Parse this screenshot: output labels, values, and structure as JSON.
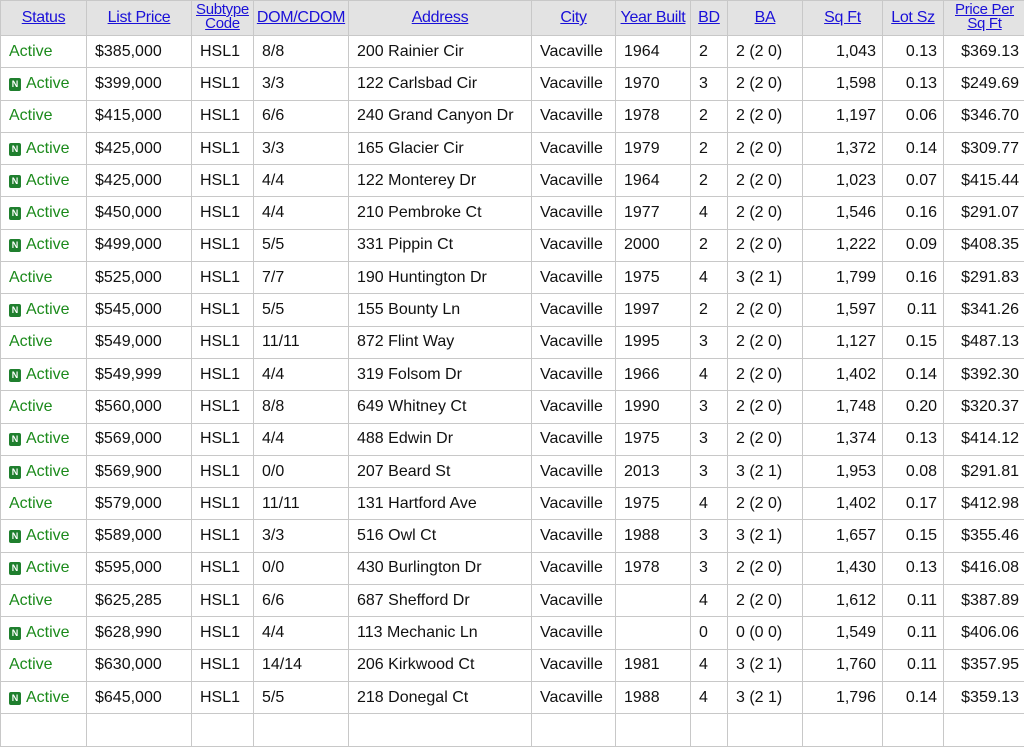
{
  "colors": {
    "header_bg": "#e3e3e3",
    "header_link": "#1a10d8",
    "status_active": "#1b8a1b",
    "new_badge": "#1f7f2e",
    "grid_line": "#c8c8c8"
  },
  "new_badge_text": "N",
  "columns": [
    {
      "key": "status",
      "label": "Status",
      "lines": [
        "Status"
      ]
    },
    {
      "key": "list_price",
      "label": "List Price",
      "lines": [
        "List Price"
      ]
    },
    {
      "key": "subtype",
      "label": "Subtype Code",
      "lines": [
        "Subtype",
        "Code"
      ]
    },
    {
      "key": "dom",
      "label": "DOM/CDOM",
      "lines": [
        "DOM/CDOM"
      ]
    },
    {
      "key": "address",
      "label": "Address",
      "lines": [
        "Address"
      ]
    },
    {
      "key": "city",
      "label": "City",
      "lines": [
        "City"
      ]
    },
    {
      "key": "year_built",
      "label": "Year Built",
      "lines": [
        "Year Built"
      ]
    },
    {
      "key": "bd",
      "label": "BD",
      "lines": [
        "BD"
      ]
    },
    {
      "key": "ba",
      "label": "BA",
      "lines": [
        "BA"
      ]
    },
    {
      "key": "sqft",
      "label": "Sq Ft",
      "lines": [
        "Sq Ft"
      ]
    },
    {
      "key": "lot",
      "label": "Lot Sz",
      "lines": [
        "Lot Sz"
      ]
    },
    {
      "key": "ppsf",
      "label": "Price Per Sq Ft",
      "lines": [
        "Price Per",
        "Sq Ft"
      ]
    }
  ],
  "rows": [
    {
      "is_new": false,
      "status": "Active",
      "list_price": "$385,000",
      "subtype": "HSL1",
      "dom": "8/8",
      "address": "200 Rainier Cir",
      "city": "Vacaville",
      "year_built": "1964",
      "bd": "2",
      "ba": "2 (2 0)",
      "sqft": "1,043",
      "lot": "0.13",
      "ppsf": "$369.13"
    },
    {
      "is_new": true,
      "status": "Active",
      "list_price": "$399,000",
      "subtype": "HSL1",
      "dom": "3/3",
      "address": "122 Carlsbad Cir",
      "city": "Vacaville",
      "year_built": "1970",
      "bd": "3",
      "ba": "2 (2 0)",
      "sqft": "1,598",
      "lot": "0.13",
      "ppsf": "$249.69"
    },
    {
      "is_new": false,
      "status": "Active",
      "list_price": "$415,000",
      "subtype": "HSL1",
      "dom": "6/6",
      "address": "240 Grand Canyon Dr",
      "city": "Vacaville",
      "year_built": "1978",
      "bd": "2",
      "ba": "2 (2 0)",
      "sqft": "1,197",
      "lot": "0.06",
      "ppsf": "$346.70"
    },
    {
      "is_new": true,
      "status": "Active",
      "list_price": "$425,000",
      "subtype": "HSL1",
      "dom": "3/3",
      "address": "165 Glacier Cir",
      "city": "Vacaville",
      "year_built": "1979",
      "bd": "2",
      "ba": "2 (2 0)",
      "sqft": "1,372",
      "lot": "0.14",
      "ppsf": "$309.77"
    },
    {
      "is_new": true,
      "status": "Active",
      "list_price": "$425,000",
      "subtype": "HSL1",
      "dom": "4/4",
      "address": "122 Monterey Dr",
      "city": "Vacaville",
      "year_built": "1964",
      "bd": "2",
      "ba": "2 (2 0)",
      "sqft": "1,023",
      "lot": "0.07",
      "ppsf": "$415.44"
    },
    {
      "is_new": true,
      "status": "Active",
      "list_price": "$450,000",
      "subtype": "HSL1",
      "dom": "4/4",
      "address": "210 Pembroke Ct",
      "city": "Vacaville",
      "year_built": "1977",
      "bd": "4",
      "ba": "2 (2 0)",
      "sqft": "1,546",
      "lot": "0.16",
      "ppsf": "$291.07"
    },
    {
      "is_new": true,
      "status": "Active",
      "list_price": "$499,000",
      "subtype": "HSL1",
      "dom": "5/5",
      "address": "331 Pippin Ct",
      "city": "Vacaville",
      "year_built": "2000",
      "bd": "2",
      "ba": "2 (2 0)",
      "sqft": "1,222",
      "lot": "0.09",
      "ppsf": "$408.35"
    },
    {
      "is_new": false,
      "status": "Active",
      "list_price": "$525,000",
      "subtype": "HSL1",
      "dom": "7/7",
      "address": "190 Huntington Dr",
      "city": "Vacaville",
      "year_built": "1975",
      "bd": "4",
      "ba": "3 (2 1)",
      "sqft": "1,799",
      "lot": "0.16",
      "ppsf": "$291.83"
    },
    {
      "is_new": true,
      "status": "Active",
      "list_price": "$545,000",
      "subtype": "HSL1",
      "dom": "5/5",
      "address": "155 Bounty Ln",
      "city": "Vacaville",
      "year_built": "1997",
      "bd": "2",
      "ba": "2 (2 0)",
      "sqft": "1,597",
      "lot": "0.11",
      "ppsf": "$341.26"
    },
    {
      "is_new": false,
      "status": "Active",
      "list_price": "$549,000",
      "subtype": "HSL1",
      "dom": "11/11",
      "address": "872 Flint Way",
      "city": "Vacaville",
      "year_built": "1995",
      "bd": "3",
      "ba": "2 (2 0)",
      "sqft": "1,127",
      "lot": "0.15",
      "ppsf": "$487.13"
    },
    {
      "is_new": true,
      "status": "Active",
      "list_price": "$549,999",
      "subtype": "HSL1",
      "dom": "4/4",
      "address": "319 Folsom Dr",
      "city": "Vacaville",
      "year_built": "1966",
      "bd": "4",
      "ba": "2 (2 0)",
      "sqft": "1,402",
      "lot": "0.14",
      "ppsf": "$392.30"
    },
    {
      "is_new": false,
      "status": "Active",
      "list_price": "$560,000",
      "subtype": "HSL1",
      "dom": "8/8",
      "address": "649 Whitney Ct",
      "city": "Vacaville",
      "year_built": "1990",
      "bd": "3",
      "ba": "2 (2 0)",
      "sqft": "1,748",
      "lot": "0.20",
      "ppsf": "$320.37"
    },
    {
      "is_new": true,
      "status": "Active",
      "list_price": "$569,000",
      "subtype": "HSL1",
      "dom": "4/4",
      "address": "488 Edwin Dr",
      "city": "Vacaville",
      "year_built": "1975",
      "bd": "3",
      "ba": "2 (2 0)",
      "sqft": "1,374",
      "lot": "0.13",
      "ppsf": "$414.12"
    },
    {
      "is_new": true,
      "status": "Active",
      "list_price": "$569,900",
      "subtype": "HSL1",
      "dom": "0/0",
      "address": "207 Beard St",
      "city": "Vacaville",
      "year_built": "2013",
      "bd": "3",
      "ba": "3 (2 1)",
      "sqft": "1,953",
      "lot": "0.08",
      "ppsf": "$291.81"
    },
    {
      "is_new": false,
      "status": "Active",
      "list_price": "$579,000",
      "subtype": "HSL1",
      "dom": "11/11",
      "address": "131 Hartford Ave",
      "city": "Vacaville",
      "year_built": "1975",
      "bd": "4",
      "ba": "2 (2 0)",
      "sqft": "1,402",
      "lot": "0.17",
      "ppsf": "$412.98"
    },
    {
      "is_new": true,
      "status": "Active",
      "list_price": "$589,000",
      "subtype": "HSL1",
      "dom": "3/3",
      "address": "516 Owl Ct",
      "city": "Vacaville",
      "year_built": "1988",
      "bd": "3",
      "ba": "3 (2 1)",
      "sqft": "1,657",
      "lot": "0.15",
      "ppsf": "$355.46"
    },
    {
      "is_new": true,
      "status": "Active",
      "list_price": "$595,000",
      "subtype": "HSL1",
      "dom": "0/0",
      "address": "430 Burlington Dr",
      "city": "Vacaville",
      "year_built": "1978",
      "bd": "3",
      "ba": "2 (2 0)",
      "sqft": "1,430",
      "lot": "0.13",
      "ppsf": "$416.08"
    },
    {
      "is_new": false,
      "status": "Active",
      "list_price": "$625,285",
      "subtype": "HSL1",
      "dom": "6/6",
      "address": "687 Shefford Dr",
      "city": "Vacaville",
      "year_built": "",
      "bd": "4",
      "ba": "2 (2 0)",
      "sqft": "1,612",
      "lot": "0.11",
      "ppsf": "$387.89"
    },
    {
      "is_new": true,
      "status": "Active",
      "list_price": "$628,990",
      "subtype": "HSL1",
      "dom": "4/4",
      "address": "113 Mechanic Ln",
      "city": "Vacaville",
      "year_built": "",
      "bd": "0",
      "ba": "0 (0 0)",
      "sqft": "1,549",
      "lot": "0.11",
      "ppsf": "$406.06"
    },
    {
      "is_new": false,
      "status": "Active",
      "list_price": "$630,000",
      "subtype": "HSL1",
      "dom": "14/14",
      "address": "206 Kirkwood Ct",
      "city": "Vacaville",
      "year_built": "1981",
      "bd": "4",
      "ba": "3 (2 1)",
      "sqft": "1,760",
      "lot": "0.11",
      "ppsf": "$357.95"
    },
    {
      "is_new": true,
      "status": "Active",
      "list_price": "$645,000",
      "subtype": "HSL1",
      "dom": "5/5",
      "address": "218 Donegal Ct",
      "city": "Vacaville",
      "year_built": "1988",
      "bd": "4",
      "ba": "3 (2 1)",
      "sqft": "1,796",
      "lot": "0.14",
      "ppsf": "$359.13"
    },
    {
      "is_new": false,
      "status": "",
      "list_price": "",
      "subtype": "",
      "dom": "",
      "address": "",
      "city": "",
      "year_built": "",
      "bd": "",
      "ba": "",
      "sqft": "",
      "lot": "",
      "ppsf": ""
    }
  ]
}
